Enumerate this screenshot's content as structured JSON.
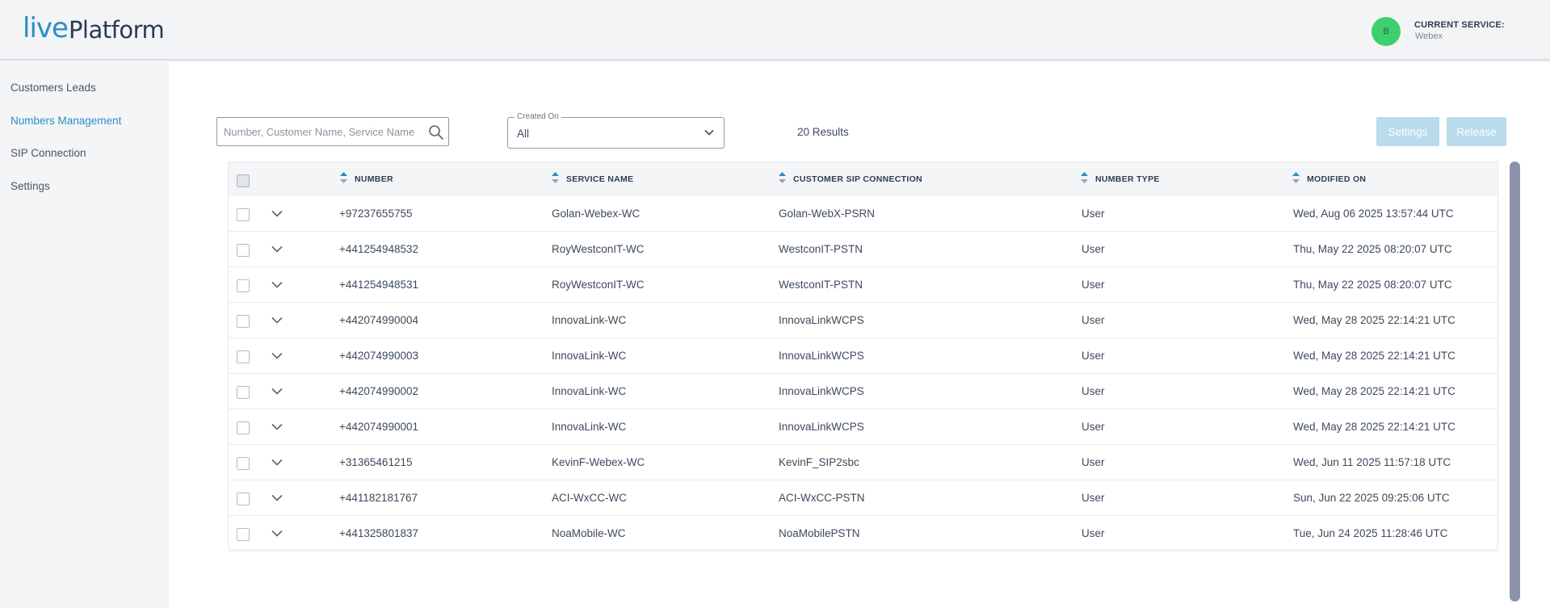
{
  "brand": {
    "logo_live": "live",
    "logo_platform": "Platform"
  },
  "header": {
    "avatar_initial": "B",
    "current_service_label": "CURRENT SERVICE:",
    "current_service_value": "Webex"
  },
  "sidebar": {
    "items": [
      {
        "label": "Customers Leads",
        "active": false
      },
      {
        "label": "Numbers Management",
        "active": true
      },
      {
        "label": "SIP Connection",
        "active": false
      },
      {
        "label": "Settings",
        "active": false
      }
    ]
  },
  "toolbar": {
    "search_placeholder": "Number, Customer Name, Service Name",
    "created_on_label": "Created On",
    "created_on_value": "All",
    "results_text": "20 Results",
    "settings_label": "Settings",
    "release_label": "Release"
  },
  "colors": {
    "accent": "#2a8fc4",
    "button_disabled": "#b9dbeb",
    "avatar": "#3ecf6f",
    "scrollbar": "#8b92aa"
  },
  "table": {
    "columns": [
      "NUMBER",
      "SERVICE NAME",
      "CUSTOMER SIP CONNECTION",
      "NUMBER TYPE",
      "MODIFIED ON"
    ],
    "rows": [
      {
        "number": "+97237655755",
        "service": "Golan-Webex-WC",
        "sip": "Golan-WebX-PSRN",
        "type": "User",
        "modified": "Wed, Aug 06 2025 13:57:44 UTC"
      },
      {
        "number": "+441254948532",
        "service": "RoyWestconIT-WC",
        "sip": "WestconIT-PSTN",
        "type": "User",
        "modified": "Thu, May 22 2025 08:20:07 UTC"
      },
      {
        "number": "+441254948531",
        "service": "RoyWestconIT-WC",
        "sip": "WestconIT-PSTN",
        "type": "User",
        "modified": "Thu, May 22 2025 08:20:07 UTC"
      },
      {
        "number": "+442074990004",
        "service": "InnovaLink-WC",
        "sip": "InnovaLinkWCPS",
        "type": "User",
        "modified": "Wed, May 28 2025 22:14:21 UTC"
      },
      {
        "number": "+442074990003",
        "service": "InnovaLink-WC",
        "sip": "InnovaLinkWCPS",
        "type": "User",
        "modified": "Wed, May 28 2025 22:14:21 UTC"
      },
      {
        "number": "+442074990002",
        "service": "InnovaLink-WC",
        "sip": "InnovaLinkWCPS",
        "type": "User",
        "modified": "Wed, May 28 2025 22:14:21 UTC"
      },
      {
        "number": "+442074990001",
        "service": "InnovaLink-WC",
        "sip": "InnovaLinkWCPS",
        "type": "User",
        "modified": "Wed, May 28 2025 22:14:21 UTC"
      },
      {
        "number": "+31365461215",
        "service": "KevinF-Webex-WC",
        "sip": "KevinF_SIP2sbc",
        "type": "User",
        "modified": "Wed, Jun 11 2025 11:57:18 UTC"
      },
      {
        "number": "+441182181767",
        "service": "ACI-WxCC-WC",
        "sip": "ACI-WxCC-PSTN",
        "type": "User",
        "modified": "Sun, Jun 22 2025 09:25:06 UTC"
      },
      {
        "number": "+441325801837",
        "service": "NoaMobile-WC",
        "sip": "NoaMobilePSTN",
        "type": "User",
        "modified": "Tue, Jun 24 2025 11:28:46 UTC"
      }
    ]
  }
}
